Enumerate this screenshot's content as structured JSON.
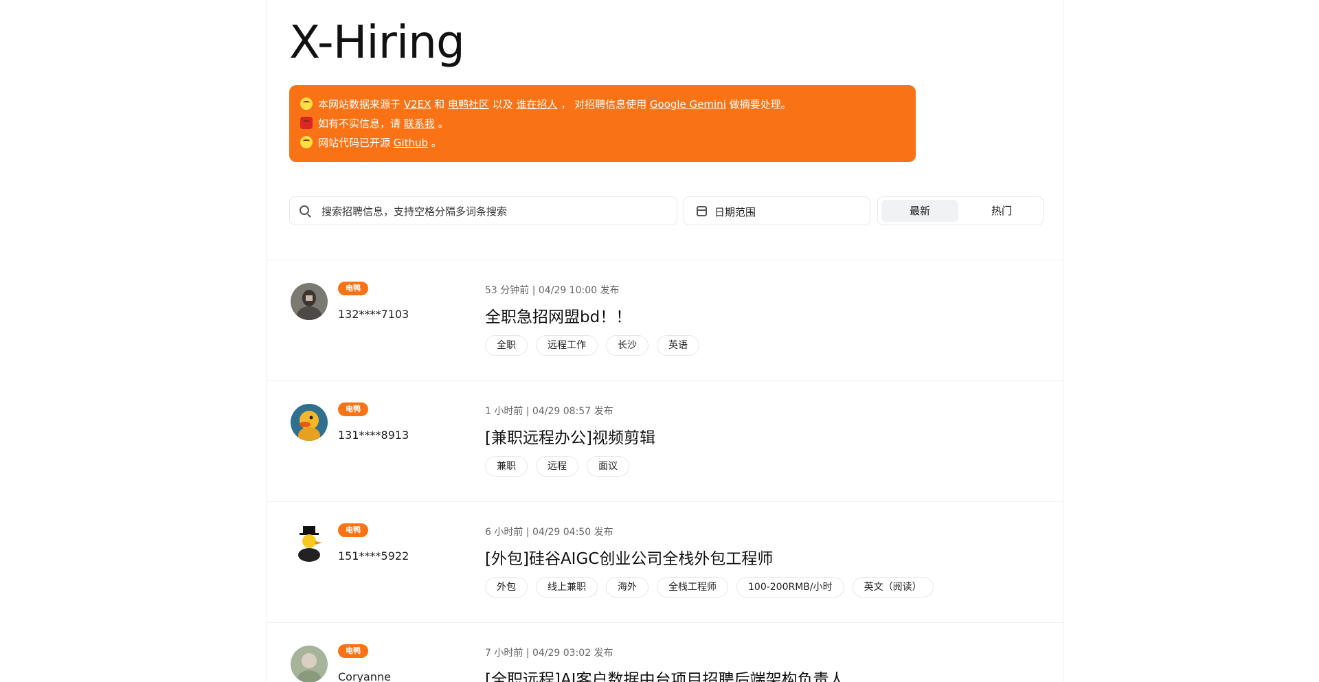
{
  "site": {
    "title": "X-Hiring"
  },
  "notice": {
    "line1": {
      "prefix": "本网站数据来源于",
      "link_v2ex": "V2EX",
      "and": "和",
      "link_eleduck": "电鸭社区",
      "also": "以及",
      "link_who": "谁在招人",
      "mid": "， 对招聘信息使用",
      "link_gemini": "Google Gemini",
      "suffix": "做摘要处理。"
    },
    "line2": {
      "prefix": "如有不实信息，请",
      "link_contact": "联系我",
      "suffix": "。"
    },
    "line3": {
      "prefix": "网站代码已开源",
      "link_github": "Github",
      "suffix": "。"
    }
  },
  "search": {
    "placeholder": "搜索招聘信息，支持空格分隔多词条搜索"
  },
  "date_filter": {
    "label": "日期范围"
  },
  "sort": {
    "latest": "最新",
    "hot": "热门"
  },
  "posts": [
    {
      "source": "电鸭",
      "user": "132****7103",
      "meta": "53 分钟前 | 04/29 10:00 发布",
      "title": "全职急招网盟bd！！",
      "tags": [
        "全职",
        "远程工作",
        "长沙",
        "英语"
      ]
    },
    {
      "source": "电鸭",
      "user": "131****8913",
      "meta": "1 小时前 | 04/29 08:57 发布",
      "title": "[兼职远程办公]视频剪辑",
      "tags": [
        "兼职",
        "远程",
        "面议"
      ]
    },
    {
      "source": "电鸭",
      "user": "151****5922",
      "meta": "6 小时前 | 04/29 04:50 发布",
      "title": "[外包]硅谷AIGC创业公司全栈外包工程师",
      "tags": [
        "外包",
        "线上兼职",
        "海外",
        "全栈工程师",
        "100-200RMB/小时",
        "英文（阅读）"
      ]
    },
    {
      "source": "电鸭",
      "user": "Coryanne",
      "meta": "7 小时前 | 04/29 03:02 发布",
      "title": "[全职远程]AI客户数据中台项目招聘后端架构负责人",
      "tags": []
    }
  ]
}
